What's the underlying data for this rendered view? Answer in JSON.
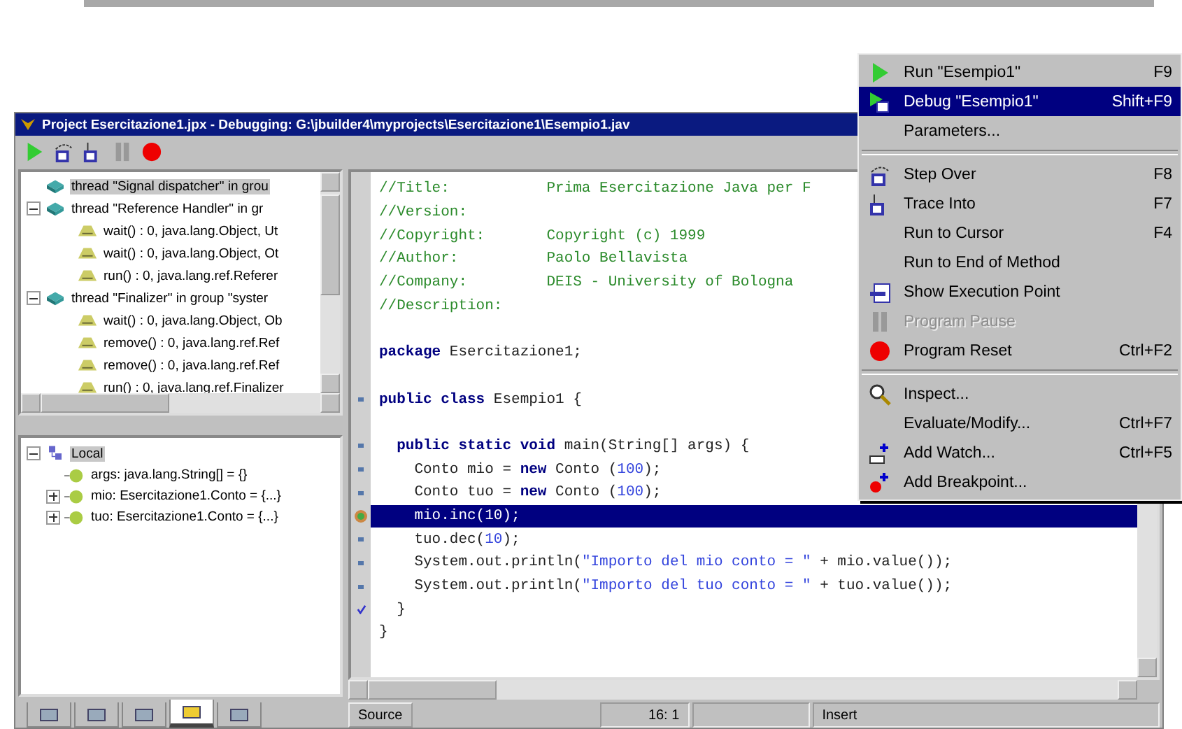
{
  "window": {
    "title": "Project Esercitazione1.jpx - Debugging: G:\\jbuilder4\\myprojects\\Esercitazione1\\Esempio1.jav"
  },
  "threads": [
    {
      "label": "thread \"Signal dispatcher\" in grou",
      "selected": true
    },
    {
      "label": "thread \"Reference Handler\" in gr",
      "selected": false,
      "expanded": true,
      "children": [
        {
          "label": "wait() : 0, java.lang.Object, Ut",
          "selected": false
        },
        {
          "label": "wait() : 0, java.lang.Object, Ot",
          "selected": false
        },
        {
          "label": "run() : 0, java.lang.ref.Referer",
          "selected": false
        }
      ]
    },
    {
      "label": "thread \"Finalizer\" in group \"syster",
      "selected": false,
      "expanded": true,
      "children": [
        {
          "label": "wait() : 0, java.lang.Object, Ob",
          "selected": false
        },
        {
          "label": "remove() : 0, java.lang.ref.Ref",
          "selected": false
        },
        {
          "label": "remove() : 0, java.lang.ref.Ref",
          "selected": false
        },
        {
          "label": "run() : 0, java.lang.ref.Finalizer",
          "selected": false
        }
      ]
    }
  ],
  "variables": [
    {
      "label": "Local",
      "selected": true,
      "expanded": true,
      "children": [
        {
          "label": "args: java.lang.String[] = {}",
          "selected": false
        },
        {
          "label": "mio: Esercitazione1.Conto = {...}",
          "selected": false,
          "expanded": false
        },
        {
          "label": "tuo: Esercitazione1.Conto = {...}",
          "selected": false,
          "expanded": false
        }
      ]
    }
  ],
  "debug_tabs": [
    {
      "selected": false
    },
    {
      "selected": false
    },
    {
      "selected": false
    },
    {
      "selected": true
    },
    {
      "selected": false
    }
  ],
  "code_lines": [
    {
      "kind": "plain",
      "tokens": [
        {
          "kind": "comment",
          "text": "//Title:           Prima Esercitazione Java per F"
        }
      ]
    },
    {
      "kind": "plain",
      "tokens": [
        {
          "kind": "comment",
          "text": "//Version:"
        }
      ]
    },
    {
      "kind": "plain",
      "tokens": [
        {
          "kind": "comment",
          "text": "//Copyright:       Copyright (c) 1999"
        }
      ]
    },
    {
      "kind": "plain",
      "tokens": [
        {
          "kind": "comment",
          "text": "//Author:          Paolo Bellavista"
        }
      ]
    },
    {
      "kind": "plain",
      "tokens": [
        {
          "kind": "comment",
          "text": "//Company:         DEIS - University of Bologna"
        }
      ]
    },
    {
      "kind": "plain",
      "tokens": [
        {
          "kind": "comment",
          "text": "//Description:"
        }
      ]
    },
    {
      "kind": "blank"
    },
    {
      "kind": "plain",
      "tokens": [
        {
          "kind": "keyword",
          "text": "package"
        },
        {
          "kind": "code",
          "text": " Esercitazione1;"
        }
      ]
    },
    {
      "kind": "blank"
    },
    {
      "kind": "marked",
      "tokens": [
        {
          "kind": "keyword",
          "text": "public class"
        },
        {
          "kind": "code",
          "text": " Esempio1 {"
        }
      ]
    },
    {
      "kind": "blank"
    },
    {
      "kind": "marked",
      "tokens": [
        {
          "kind": "keyword",
          "text": "  public static void"
        },
        {
          "kind": "code",
          "text": " main(String[] args) {"
        }
      ]
    },
    {
      "kind": "marked",
      "tokens": [
        {
          "kind": "code",
          "text": "    Conto mio = "
        },
        {
          "kind": "keyword",
          "text": "new"
        },
        {
          "kind": "code",
          "text": " Conto ("
        },
        {
          "kind": "number",
          "text": "100"
        },
        {
          "kind": "code",
          "text": ");"
        }
      ]
    },
    {
      "kind": "marked",
      "tokens": [
        {
          "kind": "code",
          "text": "    Conto tuo = "
        },
        {
          "kind": "keyword",
          "text": "new"
        },
        {
          "kind": "code",
          "text": " Conto ("
        },
        {
          "kind": "number",
          "text": "100"
        },
        {
          "kind": "code",
          "text": ");"
        }
      ]
    },
    {
      "kind": "current",
      "tokens": [
        {
          "kind": "code",
          "text": "    mio.inc("
        },
        {
          "kind": "number",
          "text": "10"
        },
        {
          "kind": "code",
          "text": ");"
        }
      ]
    },
    {
      "kind": "marked",
      "tokens": [
        {
          "kind": "code",
          "text": "    tuo.dec("
        },
        {
          "kind": "number",
          "text": "10"
        },
        {
          "kind": "code",
          "text": ");"
        }
      ]
    },
    {
      "kind": "marked",
      "tokens": [
        {
          "kind": "code",
          "text": "    System.out.println("
        },
        {
          "kind": "string",
          "text": "\"Importo del mio conto = \""
        },
        {
          "kind": "code",
          "text": " + mio.value());"
        }
      ]
    },
    {
      "kind": "marked",
      "tokens": [
        {
          "kind": "code",
          "text": "    System.out.println("
        },
        {
          "kind": "string",
          "text": "\"Importo del tuo conto = \""
        },
        {
          "kind": "code",
          "text": " + tuo.value());"
        }
      ]
    },
    {
      "kind": "ended",
      "tokens": [
        {
          "kind": "code",
          "text": "  }"
        }
      ]
    },
    {
      "kind": "plain",
      "tokens": [
        {
          "kind": "code",
          "text": "}"
        }
      ]
    }
  ],
  "status_bar": {
    "tab": "Source",
    "position": "16: 1",
    "mode": "Insert"
  },
  "menu": [
    {
      "kind": "item",
      "label": "Run \"Esempio1\"",
      "shortcut": "F9",
      "selected": false,
      "disabled": false
    },
    {
      "kind": "item",
      "label": "Debug \"Esempio1\"",
      "shortcut": "Shift+F9",
      "selected": true,
      "disabled": false
    },
    {
      "kind": "item",
      "label": "Parameters...",
      "selected": false,
      "disabled": false
    },
    {
      "kind": "separator"
    },
    {
      "kind": "item",
      "label": "Step Over",
      "shortcut": "F8",
      "selected": false,
      "disabled": false
    },
    {
      "kind": "item",
      "label": "Trace Into",
      "shortcut": "F7",
      "selected": false,
      "disabled": false
    },
    {
      "kind": "item",
      "label": "Run to Cursor",
      "shortcut": "F4",
      "selected": false,
      "disabled": false
    },
    {
      "kind": "item",
      "label": "Run to End of Method",
      "selected": false,
      "disabled": false
    },
    {
      "kind": "item",
      "label": "Show Execution Point",
      "selected": false,
      "disabled": false
    },
    {
      "kind": "item",
      "label": "Program Pause",
      "selected": false,
      "disabled": true
    },
    {
      "kind": "item",
      "label": "Program Reset",
      "shortcut": "Ctrl+F2",
      "selected": false,
      "disabled": false
    },
    {
      "kind": "separator"
    },
    {
      "kind": "item",
      "label": "Inspect...",
      "selected": false,
      "disabled": false
    },
    {
      "kind": "item",
      "label": "Evaluate/Modify...",
      "shortcut": "Ctrl+F7",
      "selected": false,
      "disabled": false
    },
    {
      "kind": "item",
      "label": "Add Watch...",
      "shortcut": "Ctrl+F5",
      "selected": false,
      "disabled": false
    },
    {
      "kind": "item",
      "label": "Add Breakpoint...",
      "selected": false,
      "disabled": false
    }
  ]
}
